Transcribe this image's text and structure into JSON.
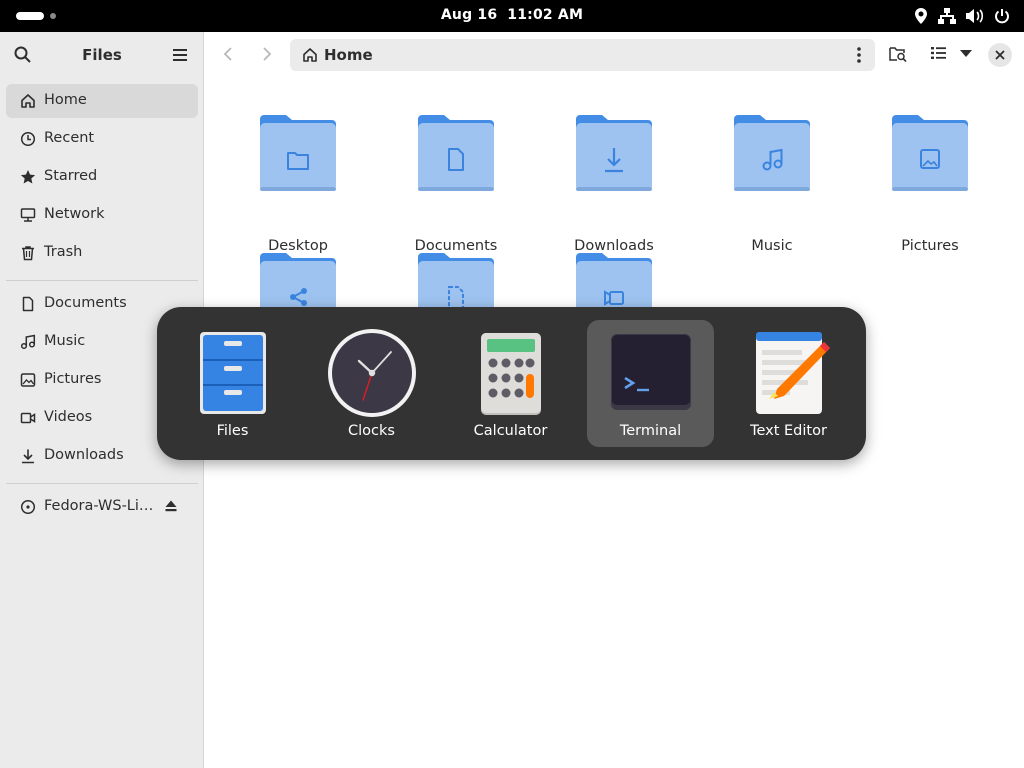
{
  "topbar": {
    "date": "Aug 16",
    "time": "11:02 AM",
    "tray_icons": [
      "location-icon",
      "network-icon",
      "volume-icon",
      "power-icon"
    ]
  },
  "sidebar": {
    "title": "Files",
    "places": [
      {
        "label": "Home",
        "icon": "home-icon",
        "active": true
      },
      {
        "label": "Recent",
        "icon": "clock-icon"
      },
      {
        "label": "Starred",
        "icon": "star-icon"
      },
      {
        "label": "Network",
        "icon": "network-icon"
      },
      {
        "label": "Trash",
        "icon": "trash-icon"
      }
    ],
    "bookmarks": [
      {
        "label": "Documents",
        "icon": "document-icon"
      },
      {
        "label": "Music",
        "icon": "music-icon"
      },
      {
        "label": "Pictures",
        "icon": "picture-icon"
      },
      {
        "label": "Videos",
        "icon": "video-icon"
      },
      {
        "label": "Downloads",
        "icon": "download-icon"
      }
    ],
    "devices": [
      {
        "label": "Fedora-WS-Li…",
        "icon": "disc-icon"
      }
    ]
  },
  "header": {
    "path_label": "Home"
  },
  "content": {
    "folders": [
      {
        "label": "Desktop",
        "emblem": "folder-emblem"
      },
      {
        "label": "Documents",
        "emblem": "document-emblem"
      },
      {
        "label": "Downloads",
        "emblem": "download-emblem"
      },
      {
        "label": "Music",
        "emblem": "music-emblem"
      },
      {
        "label": "Pictures",
        "emblem": "picture-emblem"
      },
      {
        "label": "",
        "emblem": "share-emblem"
      },
      {
        "label": "",
        "emblem": "template-emblem"
      },
      {
        "label": "",
        "emblem": "video-emblem"
      }
    ]
  },
  "switcher": {
    "apps": [
      {
        "label": "Files",
        "selected": false
      },
      {
        "label": "Clocks",
        "selected": false
      },
      {
        "label": "Calculator",
        "selected": false
      },
      {
        "label": "Terminal",
        "selected": true
      },
      {
        "label": "Text Editor",
        "selected": false
      }
    ]
  },
  "colors": {
    "folder_fill": "#9ec3f0",
    "folder_tab": "#438de6",
    "switcher_bg": "#333333",
    "selected_bg": "#5a5a5a"
  }
}
